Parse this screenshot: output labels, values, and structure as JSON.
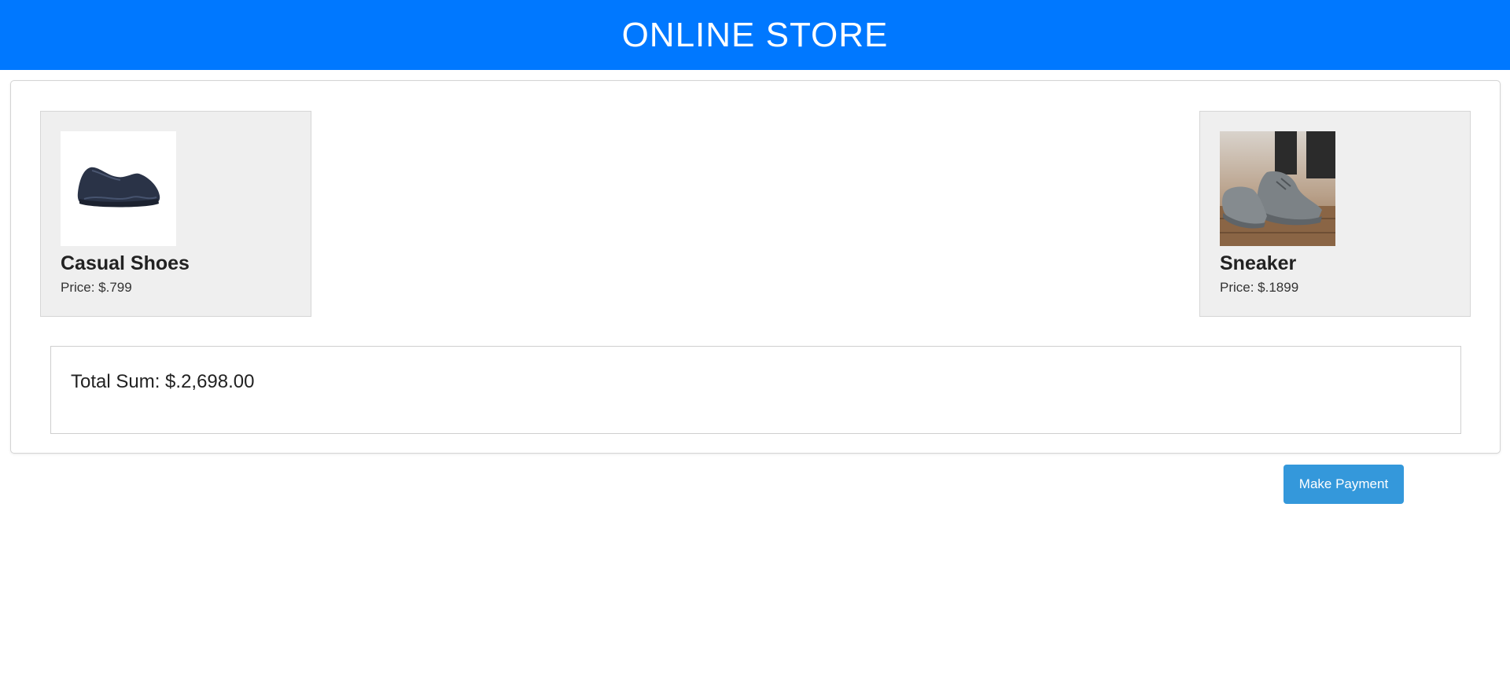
{
  "header": {
    "title": "ONLINE STORE"
  },
  "products": [
    {
      "name": "Casual Shoes",
      "price": "Price: $.799",
      "image": "casual-shoe-image"
    },
    {
      "name": "Sneaker",
      "price": "Price: $.1899",
      "image": "sneaker-image"
    }
  ],
  "cart": {
    "total": "Total Sum: $.2,698.00"
  },
  "actions": {
    "pay_label": "Make Payment"
  },
  "colors": {
    "header_bg": "#0078ff",
    "button_bg": "#3498db",
    "card_bg": "#efefef"
  }
}
